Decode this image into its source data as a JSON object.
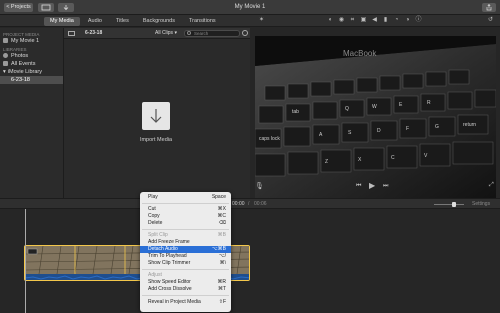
{
  "titlebar": {
    "projects_label": "< Projects",
    "title": "My Movie 1"
  },
  "tabs": [
    "My Media",
    "Audio",
    "Titles",
    "Backgrounds",
    "Transitions"
  ],
  "sidebar": {
    "project_media_heading": "PROJECT MEDIA",
    "project_item": "My Movie 1",
    "libraries_heading": "LIBRARIES",
    "photos": "Photos",
    "all_events": "All Events",
    "library": "iMovie Library",
    "event": "6-23-18"
  },
  "browser": {
    "event_date": "6-23-18",
    "filter": "All Clips",
    "search_placeholder": "Search",
    "import_label": "Import Media"
  },
  "viewer": {
    "laptop_brand": "MacBook"
  },
  "timeline_toolbar": {
    "timecode_current": "00:00",
    "timecode_separator": "/",
    "timecode_total": "00:06",
    "settings_label": "Settings"
  },
  "context_menu": {
    "items": [
      {
        "label": "Play",
        "shortcut": "Space",
        "enabled": true
      },
      {
        "label": "Cut",
        "shortcut": "⌘X",
        "enabled": true
      },
      {
        "label": "Copy",
        "shortcut": "⌘C",
        "enabled": true
      },
      {
        "label": "Delete",
        "shortcut": "⌫",
        "enabled": true
      },
      {
        "label": "Split Clip",
        "shortcut": "⌘B",
        "enabled": false
      },
      {
        "label": "Add Freeze Frame",
        "shortcut": "",
        "enabled": true
      },
      {
        "label": "Detach Audio",
        "shortcut": "⌥⌘B",
        "enabled": true,
        "highlighted": true
      },
      {
        "label": "Trim To Playhead",
        "shortcut": "⌥/",
        "enabled": true
      },
      {
        "label": "Show Clip Trimmer",
        "shortcut": "⌘\\",
        "enabled": true
      },
      {
        "label": "Adjust",
        "shortcut": "",
        "enabled": false
      },
      {
        "label": "Show Speed Editor",
        "shortcut": "⌘R",
        "enabled": true
      },
      {
        "label": "Add Cross Dissolve",
        "shortcut": "⌘T",
        "enabled": true
      },
      {
        "label": "Reveal in Project Media",
        "shortcut": "⇧F",
        "enabled": true
      }
    ]
  },
  "colors": {
    "accent": "#2a6fd6",
    "clip_border": "#f3c74b",
    "audio_wave": "#2b6cc4"
  }
}
